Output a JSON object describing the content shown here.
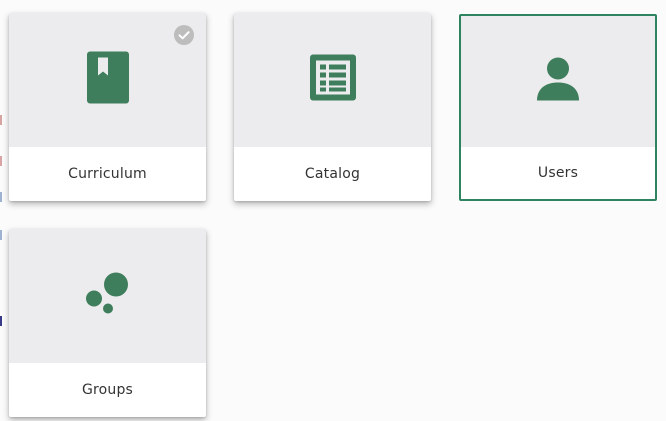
{
  "colors": {
    "accent": "#3f7e5c",
    "selected_border": "#2e8361",
    "tile_top": "#ececee"
  },
  "tiles": [
    {
      "label": "Curriculum",
      "icon": "book-icon",
      "badge": "check-circle-icon"
    },
    {
      "label": "Catalog",
      "icon": "list-icon"
    },
    {
      "label": "Users",
      "icon": "person-icon",
      "selected": true
    },
    {
      "label": "Groups",
      "icon": "bubbles-icon"
    }
  ]
}
